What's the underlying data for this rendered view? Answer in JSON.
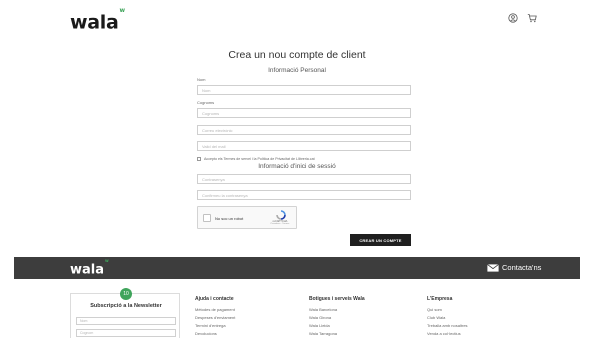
{
  "header": {
    "logo_text": "wala",
    "logo_mark": "w",
    "icons": [
      "user-icon",
      "cart-icon"
    ]
  },
  "form": {
    "title": "Crea un nou compte de client",
    "personal_section": "Informació Personal",
    "name_label": "Nom",
    "name_placeholder": "Nom",
    "surname_label": "Cognoms",
    "surname_placeholder": "Cognoms",
    "email_placeholder": "Correu electrònic",
    "email_confirm_placeholder": "Valid del mail",
    "terms_text": "Accepto els Termes de servei i la Política de Privacitat de Llibreria.cat",
    "login_section": "Informació d'inici de sessió",
    "password_placeholder": "Contrasenya",
    "password_confirm_placeholder": "Confirmeu la contrasenya",
    "recaptcha": {
      "label": "No soc un robot",
      "brand": "reCAPTCHA",
      "links": "Privadesa - Termes"
    },
    "submit_label": "CREAR UN COMPTE"
  },
  "footer": {
    "logo_text": "wala",
    "logo_mark": "w",
    "contact_label": "Contacta'ns",
    "newsletter": {
      "badge": "10",
      "title": "Subscripció a la Newsletter",
      "name_placeholder": "Nom",
      "surname_placeholder": "Cognom"
    },
    "columns": [
      {
        "title": "Ajuda i contacte",
        "links": [
          "Mètodes de pagament",
          "Despeses d'enviament",
          "Termini d'entrega",
          "Devolucions"
        ]
      },
      {
        "title": "Botigues i serveis Wala",
        "links": [
          "Wala Barcelona",
          "Wala Girona",
          "Wala Lleida",
          "Wala Tarragona"
        ]
      },
      {
        "title": "L'Empresa",
        "links": [
          "Qui som",
          "Club Wala",
          "Treballa amb nosaltres",
          "Venda a col·lectius"
        ]
      }
    ],
    "colors": {
      "bar": "#3d3d3d",
      "accent": "#3fa45b"
    }
  }
}
